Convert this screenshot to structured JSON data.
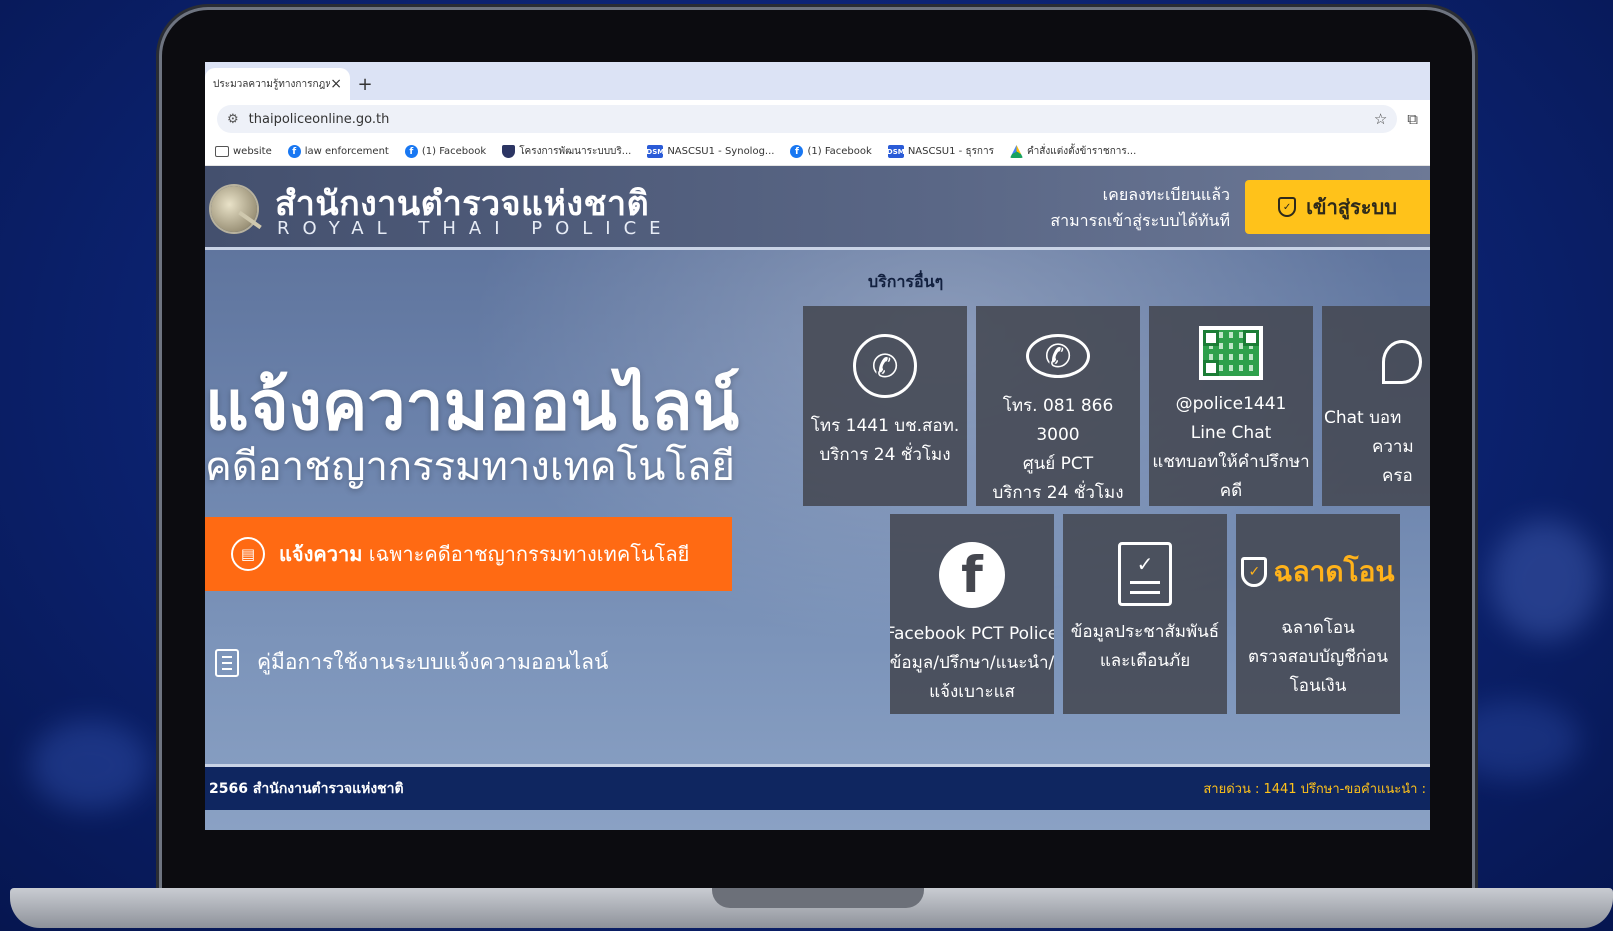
{
  "browser": {
    "tab_title": "ประมวลความรู้ทางการกฎหมาย",
    "tab_close": "×",
    "new_tab": "+",
    "url": "thaipoliceonline.go.th",
    "bookmarks": [
      {
        "label": "website",
        "icon": "folder-icon"
      },
      {
        "label": "law enforcement",
        "icon": "facebook-icon"
      },
      {
        "label": "(1) Facebook",
        "icon": "facebook-icon"
      },
      {
        "label": "โครงการพัฒนาระบบบริ...",
        "icon": "shield-icon"
      },
      {
        "label": "NASCSU1 - Synolog...",
        "icon": "dsm-icon"
      },
      {
        "label": "(1) Facebook",
        "icon": "facebook-icon"
      },
      {
        "label": "NASCSU1 - ธุรการ",
        "icon": "dsm-icon"
      },
      {
        "label": "คำสั่งแต่งตั้งข้าราชการ...",
        "icon": "drive-icon"
      }
    ]
  },
  "header": {
    "org_name_th": "สำนักงานตำรวจแห่งชาติ",
    "org_name_en": "ROYAL THAI POLICE",
    "login_hint_line1": "เคยลงทะเบียนแล้ว",
    "login_hint_line2": "สามารถเข้าสู่ระบบได้ทันที",
    "login_button": "เข้าสู่ระบบ"
  },
  "hero": {
    "title": "แจ้งความออนไลน์",
    "subtitle": "คดีอาชญากรรมทางเทคโนโลยี",
    "report_button_strong": "แจ้งความ",
    "report_button_rest": "เฉพาะคดีอาชญากรรมทางเทคโนโลยี",
    "manual_link": "คู่มือการใช้งานระบบแจ้งความออนไลน์"
  },
  "services": {
    "title": "บริการอื่นๆ",
    "cards": [
      {
        "lines": [
          "โทร 1441 บช.สอท.",
          "บริการ 24 ชั่วโมง"
        ],
        "icon": "phone-icon"
      },
      {
        "lines": [
          "โทร. 081 866",
          "3000",
          "ศูนย์ PCT",
          "บริการ 24 ชั่วโมง"
        ],
        "icon": "phone-icon"
      },
      {
        "lines": [
          "@police1441",
          "Line Chat",
          "แชทบอทให้คำปรึกษา",
          "คดี"
        ],
        "icon": "qr-code-icon"
      },
      {
        "lines": [
          "Chat บอท",
          "ความ",
          "ครอ"
        ],
        "icon": "chat-icon"
      },
      {
        "lines": [
          "Facebook PCT Police",
          "ข้อมูล/ปรึกษา/แนะนำ/",
          "แจ้งเบาะแส"
        ],
        "icon": "facebook-icon"
      },
      {
        "lines": [
          "ข้อมูลประชาสัมพันธ์",
          "และเตือนภัย"
        ],
        "icon": "checklist-icon"
      },
      {
        "brand": "ฉลาดโอน",
        "lines": [
          "ฉลาดโอน",
          "ตรวจสอบบัญชีก่อน",
          "โอนเงิน"
        ],
        "icon": "shield-check-icon"
      }
    ]
  },
  "footer": {
    "copyright": "2566 สำนักงานตำรวจแห่งชาติ",
    "hotline": "สายด่วน : 1441 ปรึกษา-ขอคำแนะนำ :"
  },
  "colors": {
    "accent_orange": "#ff6a13",
    "login_yellow": "#ffc21a",
    "footer_navy": "#0f2660"
  }
}
